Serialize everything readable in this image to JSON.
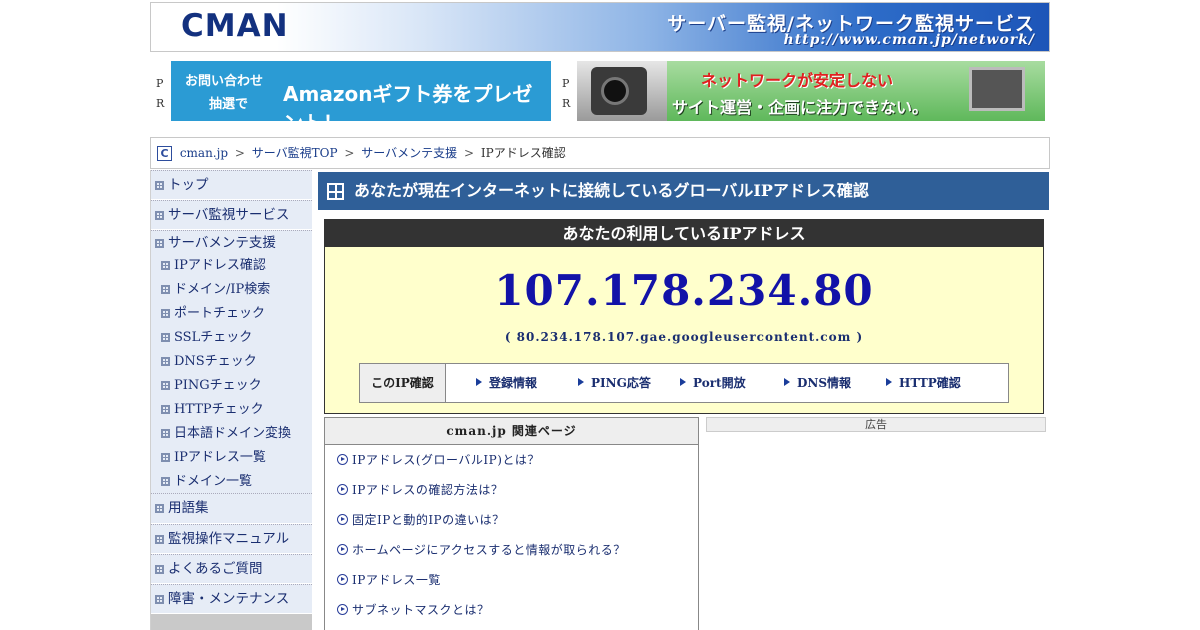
{
  "header": {
    "logo": "CMAN",
    "title": "サーバー監視/ネットワーク監視サービス",
    "url": "http://www.cman.jp/network/"
  },
  "pr": {
    "label_p": "P",
    "label_r": "R",
    "banner1": {
      "line1": "お問い合わせ",
      "line2": "抽選で",
      "main": "Amazonギフト券をプレゼント！"
    },
    "banner2": {
      "line1": "ネットワークが安定しない",
      "line2": "サイト運営・企画に注力できない。"
    }
  },
  "breadcrumb": {
    "icon": "C",
    "items": [
      "cman.jp",
      "サーバ監視TOP",
      "サーバメンテ支援",
      "IPアドレス確認"
    ],
    "separator": ">"
  },
  "sidebar": {
    "items": [
      {
        "label": "トップ",
        "level": 1
      },
      {
        "label": "サーバ監視サービス",
        "level": 1
      },
      {
        "label": "サーバメンテ支援",
        "level": 1
      },
      {
        "label": "IPアドレス確認",
        "level": 2
      },
      {
        "label": "ドメイン/IP検索",
        "level": 2
      },
      {
        "label": "ポートチェック",
        "level": 2
      },
      {
        "label": "SSLチェック",
        "level": 2
      },
      {
        "label": "DNSチェック",
        "level": 2
      },
      {
        "label": "PINGチェック",
        "level": 2
      },
      {
        "label": "HTTPチェック",
        "level": 2
      },
      {
        "label": "日本語ドメイン変換",
        "level": 2
      },
      {
        "label": "IPアドレス一覧",
        "level": 2
      },
      {
        "label": "ドメイン一覧",
        "level": 2
      },
      {
        "label": "用語集",
        "level": 1
      },
      {
        "label": "監視操作マニュアル",
        "level": 1
      },
      {
        "label": "よくあるご質問",
        "level": 1
      },
      {
        "label": "障害・メンテナンス",
        "level": 1
      }
    ]
  },
  "main": {
    "title": "あなたが現在インターネットに接続しているグローバルIPアドレス確認",
    "ip_header": "あなたの利用しているIPアドレス",
    "ip_address": "107.178.234.80",
    "hostname": "( 80.234.178.107.gae.googleusercontent.com )",
    "check_label": "このIP確認",
    "check_links": [
      "登録情報",
      "PING応答",
      "Port開放",
      "DNS情報",
      "HTTP確認"
    ]
  },
  "related": {
    "header": "cman.jp 関連ページ",
    "items": [
      "IPアドレス(グローバルIP)とは？",
      "IPアドレスの確認方法は？",
      "固定IPと動的IPの違いは？",
      "ホームページにアクセスすると情報が取られる？",
      "IPアドレス一覧",
      "サブネットマスクとは？"
    ]
  },
  "ad": {
    "label": "広告"
  },
  "colors": {
    "title_bar": "#2f5f98",
    "ip_text": "#1212a8",
    "ip_box_bg": "#ffffcc",
    "sidebar_bg": "#e6ecf6"
  }
}
